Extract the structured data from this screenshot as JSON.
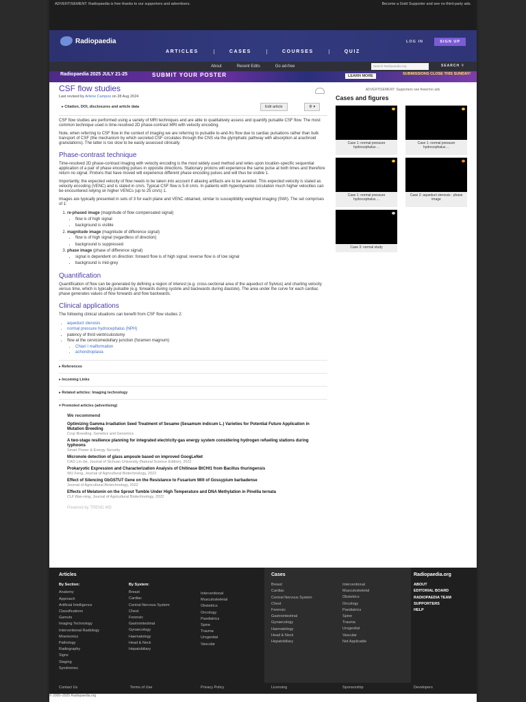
{
  "ad_top": {
    "left": "ADVERTISEMENT: Radiopaedia is free thanks to our supporters and advertisers.",
    "right": "Become a Gold Supporter and see no third-party ads."
  },
  "brand": "Radiopaedia",
  "nav": [
    "ARTICLES",
    "CASES",
    "COURSES",
    "QUIZ"
  ],
  "auth": {
    "login": "LOG IN",
    "signup": "SIGN UP"
  },
  "subnav": {
    "links": [
      "About",
      "Recent Edits",
      "Go ad-free"
    ],
    "search_placeholder": "Search Radiopaedia.org",
    "search_btn": "SEARCH"
  },
  "banner": {
    "b1": "Radiopaedia 2025 JULY 21-25",
    "b2": "SUBMIT YOUR POSTER",
    "b3": "LEARN MORE",
    "b4": "SUBMISSIONS CLOSE THIS SUNDAY!"
  },
  "article": {
    "title": "CSF flow studies",
    "meta_prefix": "Last revised by",
    "author": "Arlene Campos",
    "meta_suffix": "on 28 Aug 2024",
    "citation": "Citation, DOI, disclosures and article data",
    "edit": "Edit article",
    "gear": "⚙ ▾",
    "p1": "CSF flow studies are performed using a variety of MRI techniques and are able to qualitatively assess and quantify pulsatile CSF flow. The most common technique used is time-resolved 2D phase-contrast MRI with velocity encoding.",
    "p2": "Note, when referring to CSF flow in the context of imaging we are referring to pulsatile to-and-fro flow due to cardiac pulsations rather than bulk transport of CSF (the mechanism by which secreted CSF circulates through the CNS via the glymphatic pathway with absorption at arachnoid granulations). The latter is too slow to be easily assessed clinically.",
    "h_phase": "Phase-contrast technique",
    "p3": "Time-resolved 2D phase-contrast imaging with velocity encoding is the most widely used method and relies upon location-specific sequential application of a pair of phase encoding pulses in opposite directions. Stationary protons will experience the same pulse at both times and therefore return no signal. Protons that have moved will experience different phase encoding pulses and will thus be visible 1.",
    "p4": "Importantly, the expected velocity of flow needs to be taken into account if aliasing artifacts are to be avoided. This expected velocity is stated as velocity encoding (VENC) and is stated in cm/s. Typical CSF flow is 5-8 cm/s. In patients with hyperdynamic circulation much higher velocities can be encountered relying on higher VENCs (up to 25 cm/s) 1.",
    "p5": "Images are typically presented in sets of 3 for each plane and VENC obtained, similar to susceptibility weighted imaging (SWI). The set comprises of 1:",
    "list": [
      {
        "head": "re-phased image",
        "rest": " (magnitude of flow compensated signal)",
        "subs": [
          "flow is of high signal",
          "background is visible"
        ]
      },
      {
        "head": "magnitude image",
        "rest": " (magnitude of difference signal)",
        "subs": [
          "flow is of high signal (regardless of direction)",
          "background is suppressed"
        ]
      },
      {
        "head": "phase image",
        "rest": " (phase of difference signal)",
        "subs": [
          "signal is dependent on direction: forward flow is of high signal; reverse flow is of low signal",
          "background is mid-grey"
        ]
      }
    ],
    "h_quant": "Quantification",
    "p6": "Quantification of flow can be generated by defining a region of interest (e.g. cross-sectional area of the aqueduct of Sylvius) and charting velocity versus time, which is typically pulsatile (e.g. forwards during systole and backwards during diastole). The area under the curve for each cardiac phase generates values of flow forwards and flow backwards.",
    "h_clin": "Clinical applications",
    "p7": "The following clinical situations can benefit from CSF flow studies 2:",
    "clin": [
      "aqueduct stenosis",
      "normal pressure hydrocephalus (NPH)",
      "patency of third ventriculostomy",
      "flow at the cervicomedullary junction (foramen magnum)"
    ],
    "clin_subs": [
      "Chiari I malformation",
      "achondroplasia"
    ],
    "collapsibles": [
      "References",
      "Incoming Links",
      "Related articles: Imaging technology",
      "Promoted articles (advertising)"
    ],
    "we_recommend": "We recommend",
    "recs": [
      {
        "t": "Optimizing Gamma Irradiation Seed Treatment of Sesame (Sesamum indicum L.) Varieties for Potential Future Application in Mutation Breeding",
        "s": "Crop Breeding, Genetics and Genomics"
      },
      {
        "t": "A two-stage resilience planning for integrated electricity-gas energy system considering hydrogen refueling stations during typhoons",
        "s": "Smart Power & Energy Security"
      },
      {
        "t": "Micronole detection of glass ampoule based on improved GoogLeNet",
        "s": "CAO Lin-Jie, Journal of Sichuan University (Natural Science Edition), 2022"
      },
      {
        "t": "Prokaryotic Expression and Characterization Analysis of Chitinase BtCHI1 from Bacillus thuringensis",
        "s": "WU Feng, Journal of Agricultural Biotechnology, 2022"
      },
      {
        "t": "Effect of Silencing GbGSTU7 Gene on the Resistance to Fusarium Wilt of Gossypium barbadense",
        "s": "Journal of Agricultural Biotechnology, 2022"
      },
      {
        "t": "Effects of Melatonin on the Sprout Tumble Under High Temperature and DNA Methylation in Pinellia ternata",
        "s": "CUI Wan-ning, Journal of Agricultural Biotechnology, 2022"
      }
    ],
    "powered": "Powered by TREND MD"
  },
  "sidebar": {
    "ad": "ADVERTISEMENT: Supporters see fewer/no ads",
    "title": "Cases and figures",
    "cases": [
      "Case 1: normal pressure hydrocephalus ...",
      "Case 1: normal pressure hydrocephalus ...",
      "Case 1: normal pressure hydrocephalus ...",
      "Case 2: aqueduct stenosis : phase image",
      "Case 3: normal study"
    ]
  },
  "footer": {
    "articles": "Articles",
    "by_section": "By Section:",
    "by_system": "By System:",
    "sections": [
      "Anatomy",
      "Approach",
      "Artificial Intelligence",
      "Classifications",
      "Gamuts",
      "Imaging Technology",
      "Interventional Radiology",
      "Mnemonics",
      "Pathology",
      "Radiography",
      "Signs",
      "Staging",
      "Syndromes"
    ],
    "systems1": [
      "Breast",
      "Cardiac",
      "Central Nervous System",
      "Chest",
      "Forensic",
      "Gastrointestinal",
      "Gynaecology",
      "Haematology",
      "Head & Neck",
      "Hepatobiliary"
    ],
    "systems2": [
      "Interventional",
      "Musculoskeletal",
      "Obstetrics",
      "Oncology",
      "Paediatrics",
      "Spine",
      "Trauma",
      "Urogenital",
      "Vascular"
    ],
    "cases": "Cases",
    "cases1": [
      "Breast",
      "Cardiac",
      "Central Nervous System",
      "Chest",
      "Forensic",
      "Gastrointestinal",
      "Gynaecology",
      "Haematology",
      "Head & Neck",
      "Hepatobiliary"
    ],
    "cases2": [
      "Interventional",
      "Musculoskeletal",
      "Obstetrics",
      "Oncology",
      "Paediatrics",
      "Spine",
      "Trauma",
      "Urogenital",
      "Vascular",
      "Not Applicable"
    ],
    "org": "Radiopaedia.org",
    "orglinks": [
      "ABOUT",
      "EDITORIAL BOARD",
      "RADIOPAEDIA TEAM",
      "SUPPORTERS",
      "HELP"
    ],
    "bottom": [
      "Contact Us",
      "Terms of Use",
      "Privacy Policy",
      "Licensing",
      "Sponsorship",
      "Developers"
    ],
    "copyright": "© 2005–2025 Radiopaedia.org"
  }
}
